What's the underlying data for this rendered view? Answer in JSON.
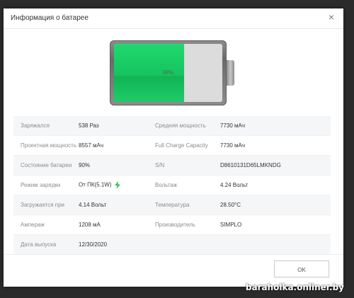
{
  "dialog": {
    "title": "Информация о батарее",
    "close_glyph": "×"
  },
  "battery": {
    "level_text": "98%",
    "level": 0.65,
    "fill_color": "#16c35e"
  },
  "info": {
    "rows": [
      {
        "label_left": "Заряжался",
        "value_left": "538 Раз",
        "label_right": "Средняя мощность",
        "value_right": "7730 мАч"
      },
      {
        "label_left": "Проектная мощность",
        "value_left": "8557 мАч",
        "label_right": "Full Charge Capacity",
        "value_right": "7730 мАч"
      },
      {
        "label_left": "Состояние батареи",
        "value_left": "90%",
        "label_right": "S/N",
        "value_right": "D8610131D65LMKNDG"
      },
      {
        "label_left": "Режим зарядки",
        "value_left": "От ПК(5.1W)",
        "label_right": "Вольтаж",
        "value_right": "4.24 Вольт"
      },
      {
        "label_left": "Загружается при",
        "value_left": "4.14 Вольт",
        "label_right": "Температура",
        "value_right": "28.50°C"
      },
      {
        "label_left": "Ампераж",
        "value_left": "1208 мА",
        "label_right": "Производитель",
        "value_right": "SIMPLO"
      },
      {
        "label_left": "Дата выпуска",
        "value_left": "12/30/2020",
        "label_right": "",
        "value_right": ""
      }
    ],
    "charging_icon": "lightning-bolt-icon",
    "accent_color": "#2ec25a"
  },
  "footer": {
    "ok_label": "OK"
  },
  "watermark": "baraholka.onliner.by"
}
